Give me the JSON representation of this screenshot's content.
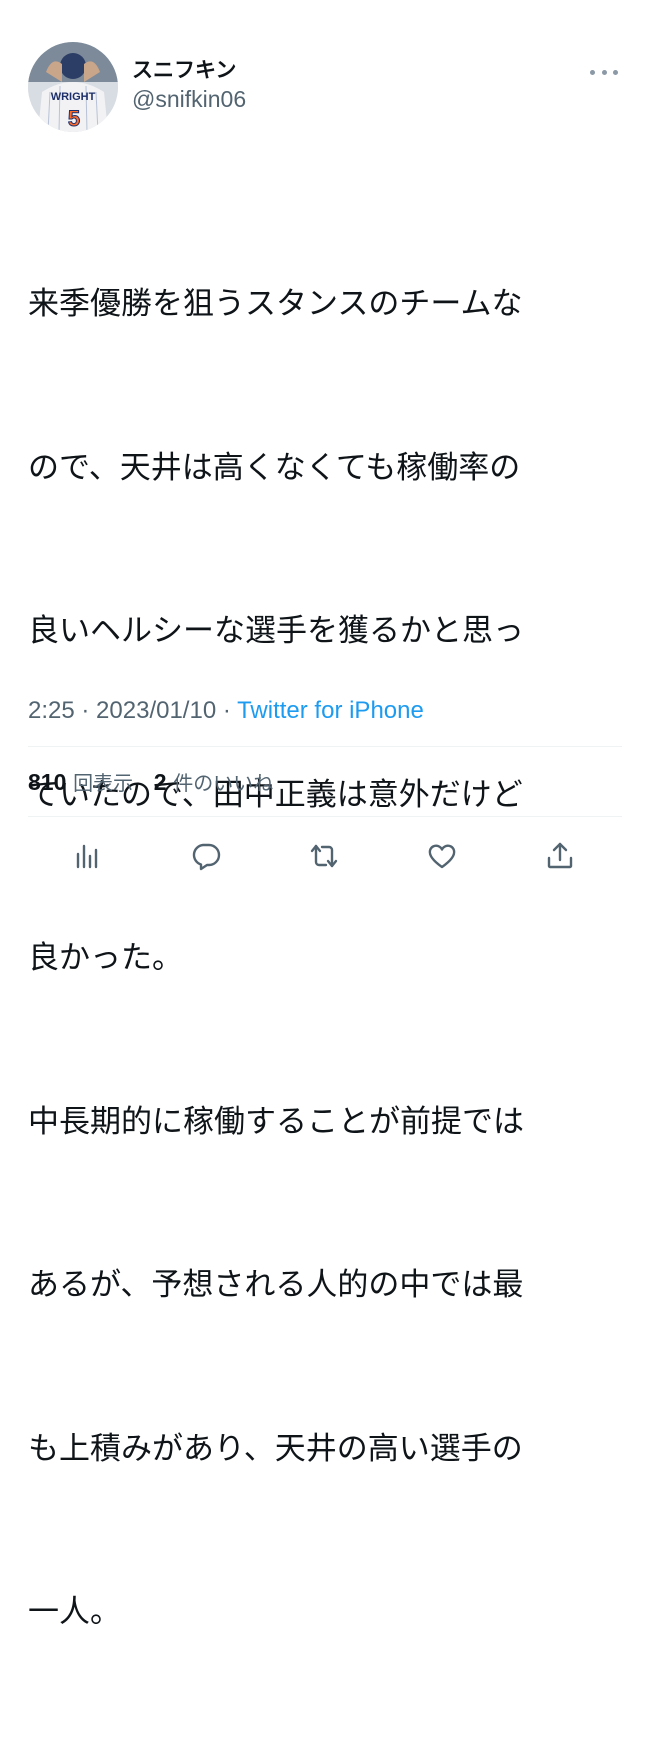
{
  "author": {
    "display_name": "スニフキン",
    "handle": "@snifkin06",
    "avatar_jersey_text": "WRIGHT",
    "avatar_number": "5"
  },
  "tweet": {
    "text_lines": [
      "来季優勝を狙うスタンスのチームな",
      "ので、天井は高くなくても稼働率の",
      "良いヘルシーな選手を獲るかと思っ",
      "ていたので、田中正義は意外だけど",
      "良かった。",
      "中長期的に稼働することが前提では",
      "あるが、予想される人的の中では最",
      "も上積みがあり、天井の高い選手の",
      "一人。"
    ]
  },
  "meta": {
    "time": "2:25",
    "separator1": " · ",
    "date": "2023/01/10",
    "separator2": " · ",
    "source": "Twitter for iPhone"
  },
  "stats": {
    "views_count": "810",
    "views_label": "回表示",
    "likes_count": "2",
    "likes_label": "件のいいね"
  },
  "actions": {
    "analytics_icon": "bar-chart-icon",
    "reply_icon": "speech-bubble-icon",
    "retweet_icon": "retweet-icon",
    "like_icon": "heart-icon",
    "share_icon": "share-icon"
  },
  "colors": {
    "text_primary": "#0f1419",
    "text_secondary": "#536471",
    "link": "#1d9bf0",
    "divider": "#eff3f4"
  }
}
